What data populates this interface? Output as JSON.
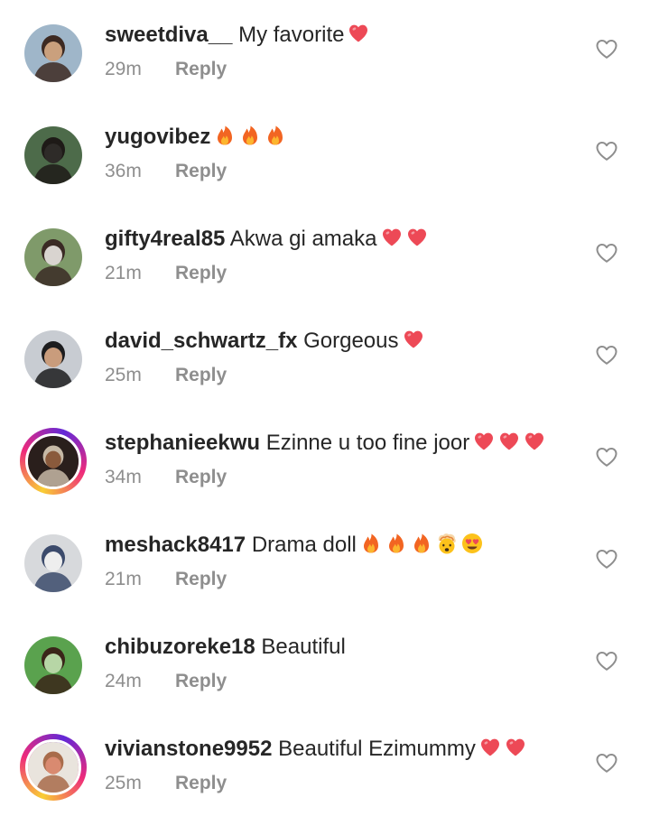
{
  "colors": {
    "text": "#262626",
    "secondary": "#8e8e8e",
    "heart_red": "#ed4956",
    "fire_orange": "#f26522",
    "story_ring": [
      "#f9ce34",
      "#ee2a7b",
      "#6228d7"
    ]
  },
  "comments": [
    {
      "username": "sweetdiva__",
      "text": "My favorite",
      "emojis": [
        "red-heart"
      ],
      "time": "29m",
      "reply_label": "Reply",
      "has_story": false,
      "avatar_palette": [
        "#9fb6c9",
        "#3d2a22",
        "#caa07d"
      ]
    },
    {
      "username": "yugovibez",
      "text": "",
      "emojis": [
        "fire",
        "fire",
        "fire"
      ],
      "time": "36m",
      "reply_label": "Reply",
      "has_story": false,
      "avatar_palette": [
        "#4d6b4a",
        "#1e1a17",
        "#2e2b28"
      ]
    },
    {
      "username": "gifty4real85",
      "text": "Akwa gi amaka",
      "emojis": [
        "red-heart",
        "red-heart"
      ],
      "time": "21m",
      "reply_label": "Reply",
      "has_story": false,
      "avatar_palette": [
        "#7f9a6a",
        "#3a2a24",
        "#d9d4d0"
      ]
    },
    {
      "username": "david_schwartz_fx",
      "text": "Gorgeous",
      "emojis": [
        "red-heart"
      ],
      "time": "25m",
      "reply_label": "Reply",
      "has_story": false,
      "avatar_palette": [
        "#c8ccd2",
        "#1c1c1e",
        "#c99c7c"
      ]
    },
    {
      "username": "stephanieekwu",
      "text": "Ezinne u too fine joor",
      "emojis": [
        "red-heart",
        "red-heart",
        "red-heart"
      ],
      "time": "34m",
      "reply_label": "Reply",
      "has_story": true,
      "avatar_palette": [
        "#2a1f1c",
        "#c7b9a6",
        "#8a5a3c"
      ]
    },
    {
      "username": "meshack8417",
      "text": "Drama doll",
      "emojis": [
        "fire",
        "fire",
        "fire",
        "exploding-head",
        "heart-eyes"
      ],
      "time": "21m",
      "reply_label": "Reply",
      "has_story": false,
      "avatar_palette": [
        "#d7d9dc",
        "#3b4a6b",
        "#eeeeee"
      ]
    },
    {
      "username": "chibuzoreke18",
      "text": "Beautiful",
      "emojis": [],
      "time": "24m",
      "reply_label": "Reply",
      "has_story": false,
      "avatar_palette": [
        "#5aa24e",
        "#3a2519",
        "#b7d6a6"
      ]
    },
    {
      "username": "vivianstone9952",
      "text": "Beautiful Ezimummy",
      "emojis": [
        "red-heart",
        "red-heart"
      ],
      "time": "25m",
      "reply_label": "Reply",
      "has_story": true,
      "avatar_palette": [
        "#e9e4dd",
        "#a86b4a",
        "#d98a70"
      ]
    }
  ]
}
